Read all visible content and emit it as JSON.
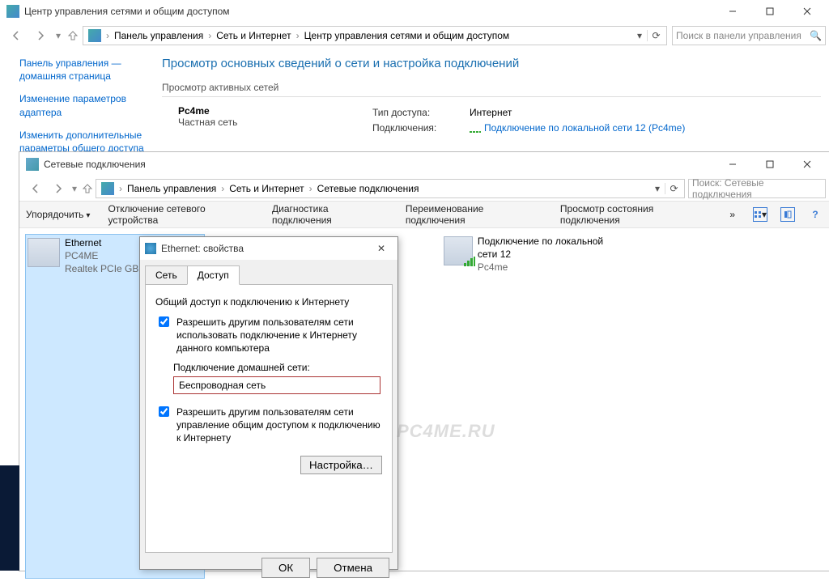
{
  "win1": {
    "title": "Центр управления сетями и общим доступом",
    "breadcrumb": [
      "Панель управления",
      "Сеть и Интернет",
      "Центр управления сетями и общим доступом"
    ],
    "search_placeholder": "Поиск в панели управления",
    "sidebar": [
      "Панель управления — домашняя страница",
      "Изменение параметров адаптера",
      "Изменить дополнительные параметры общего доступа"
    ],
    "page_title": "Просмотр основных сведений о сети и настройка подключений",
    "active_networks_label": "Просмотр активных сетей",
    "network": {
      "name": "Pc4me",
      "type": "Частная сеть",
      "access_label": "Тип доступа:",
      "access_value": "Интернет",
      "conn_label": "Подключения:",
      "conn_link": "Подключение по локальной сети 12 (Pc4me)"
    }
  },
  "win2": {
    "title": "Сетевые подключения",
    "breadcrumb": [
      "Панель управления",
      "Сеть и Интернет",
      "Сетевые подключения"
    ],
    "search_placeholder": "Поиск: Сетевые подключения",
    "toolbar": {
      "organize": "Упорядочить",
      "disable": "Отключение сетевого устройства",
      "diagnose": "Диагностика подключения",
      "rename": "Переименование подключения",
      "status": "Просмотр состояния подключения",
      "overflow": "»"
    },
    "connections": [
      {
        "name": "Ethernet",
        "line2": "PC4ME",
        "line3": "Realtek PCIe GBE"
      },
      {
        "name": "Подключение по локальной сети 12",
        "line2": "",
        "line3": "Pc4me"
      }
    ]
  },
  "dialog": {
    "title": "Ethernet: свойства",
    "tabs": {
      "network": "Сеть",
      "sharing": "Доступ"
    },
    "group_label": "Общий доступ к подключению к Интернету",
    "chk1": "Разрешить другим пользователям сети использовать подключение к Интернету данного компьютера",
    "home_label": "Подключение домашней сети:",
    "home_value": "Беспроводная сеть",
    "chk2": "Разрешить другим пользователям сети управление общим доступом к подключению к Интернету",
    "settings_btn": "Настройка…",
    "ok": "ОК",
    "cancel": "Отмена"
  },
  "watermark": "PC4ME.RU"
}
